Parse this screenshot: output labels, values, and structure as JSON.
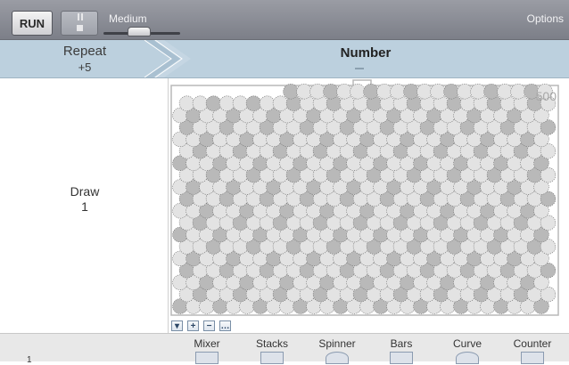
{
  "toolbar": {
    "run_label": "RUN",
    "speed_label": "Medium",
    "options_label": "Options"
  },
  "header": {
    "repeat_label": "Repeat",
    "repeat_value": "+5",
    "title": "Number"
  },
  "draw": {
    "label": "Draw",
    "value": "1"
  },
  "container": {
    "count": "500",
    "rows": 18,
    "per_row": 28,
    "top_row_balls": 20
  },
  "controls": [
    "▾",
    "+",
    "−",
    "…"
  ],
  "palette": {
    "items": [
      "Mixer",
      "Stacks",
      "Spinner",
      "Bars",
      "Curve",
      "Counter"
    ],
    "left_marker": "1"
  },
  "colors": {
    "toolbar": "#8a8d95",
    "header_band": "#bcd0de",
    "ball_light": "#e3e3e3",
    "ball_dark": "#b9b9b9"
  }
}
